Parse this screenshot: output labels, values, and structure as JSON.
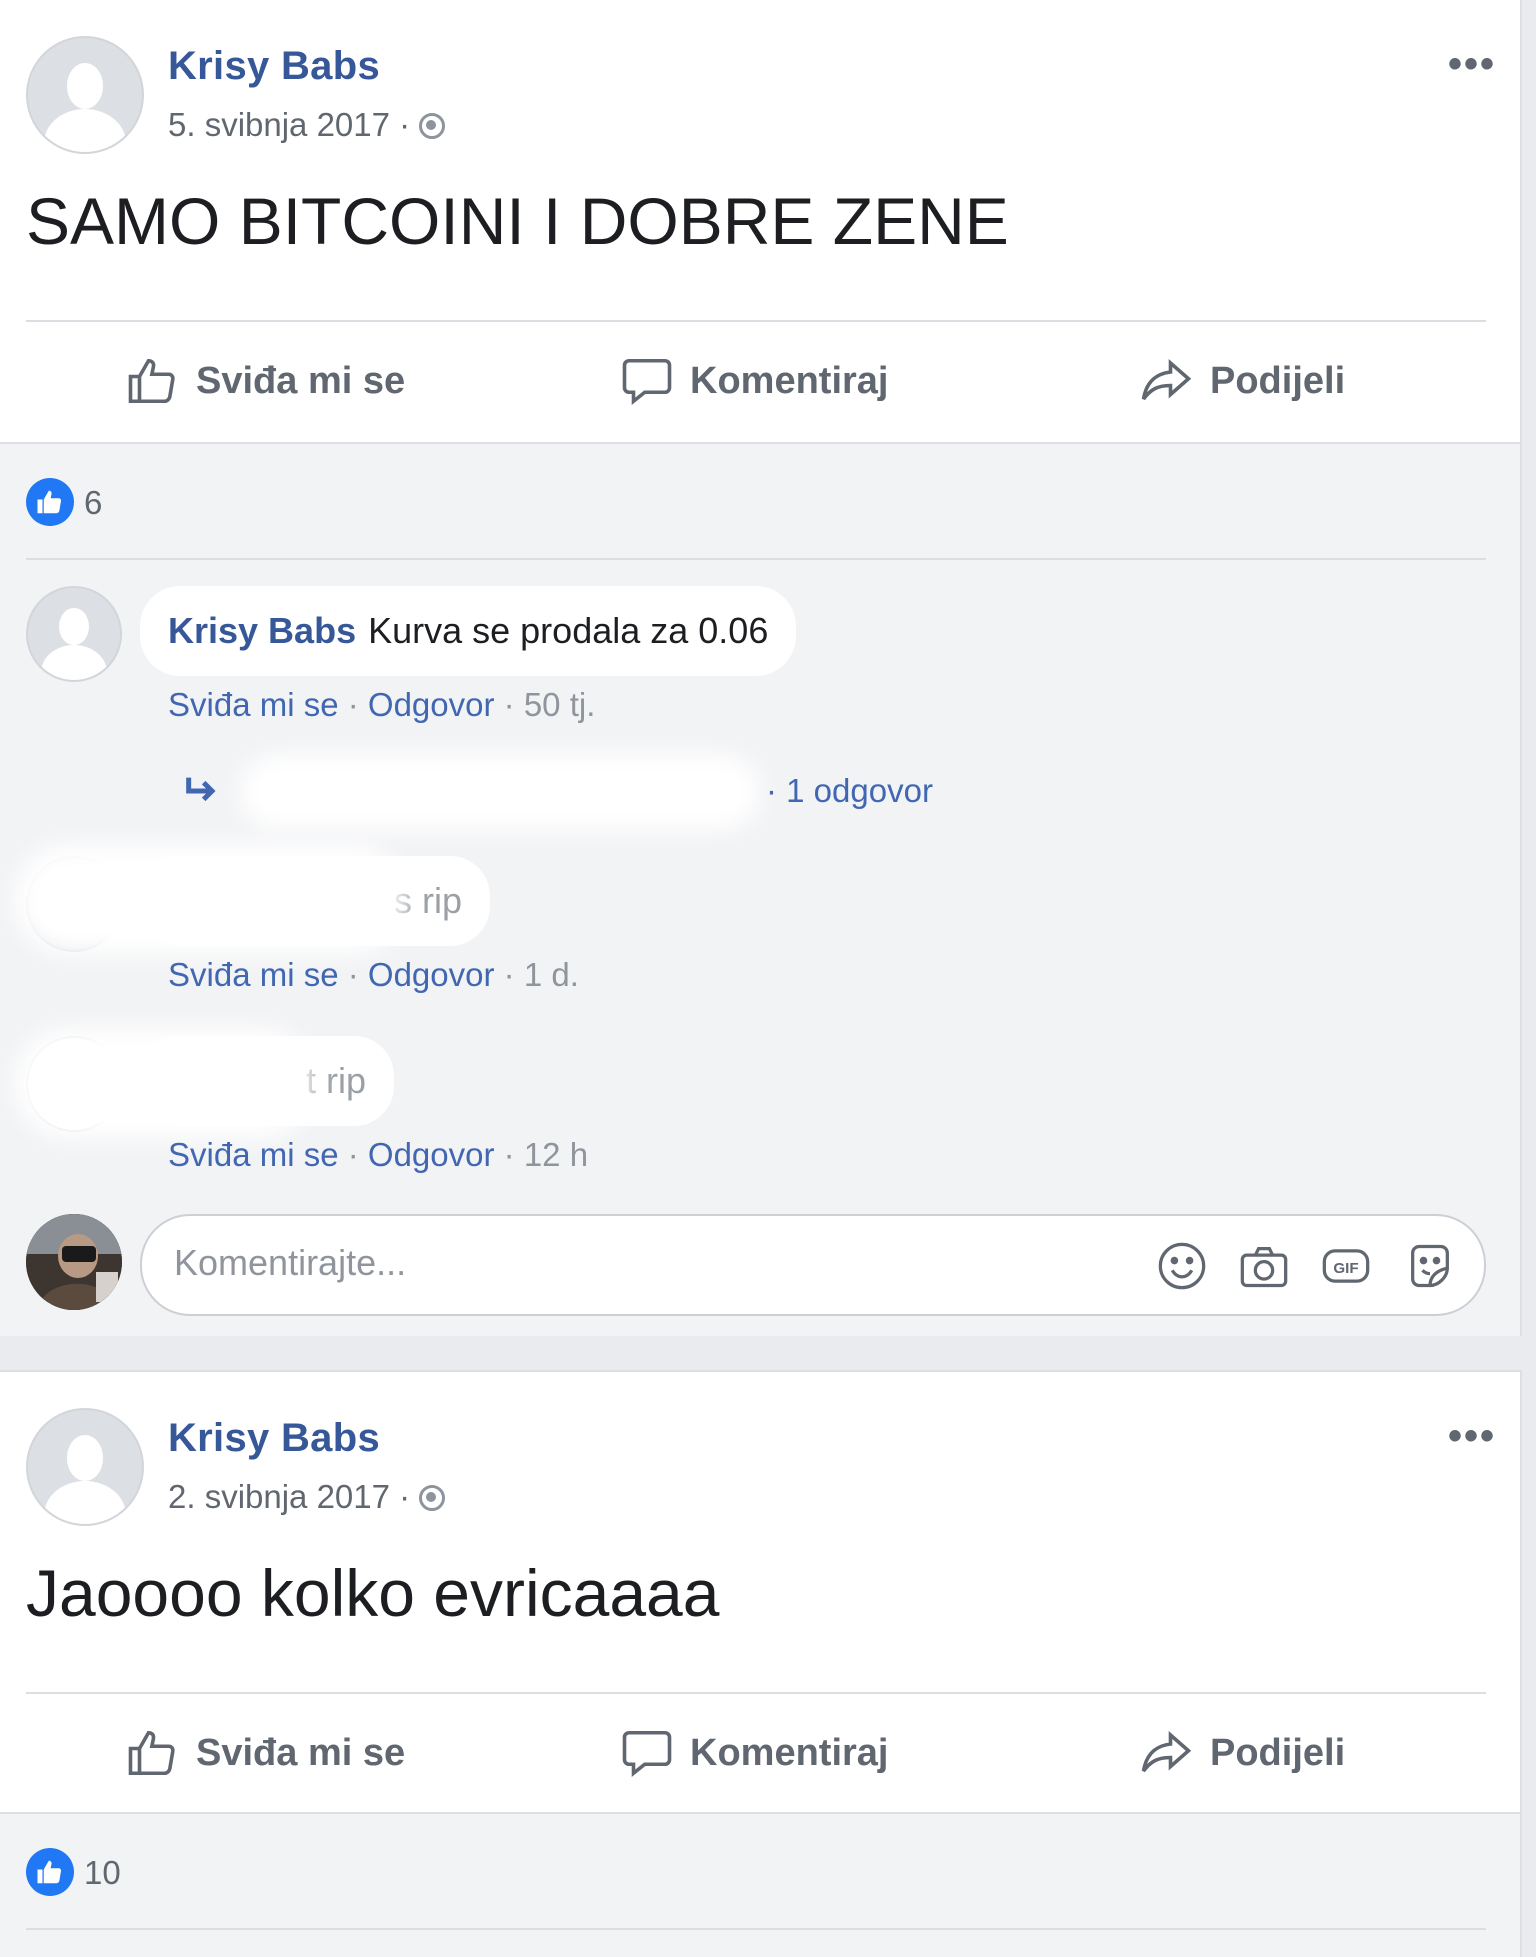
{
  "posts": [
    {
      "author": "Krisy Babs",
      "date": "5. svibnja 2017",
      "separator": "·",
      "more_label": "•••",
      "text": "SAMO BITCOINI I DOBRE ZENE",
      "actions": {
        "like": "Sviđa mi se",
        "comment": "Komentiraj",
        "share": "Podijeli"
      },
      "reactions_count": "6"
    },
    {
      "author": "Krisy Babs",
      "date": "2. svibnja 2017",
      "separator": "·",
      "more_label": "•••",
      "text": "Jaoooo kolko evricaaaa",
      "actions": {
        "like": "Sviđa mi se",
        "comment": "Komentiraj",
        "share": "Podijeli"
      },
      "reactions_count": "10"
    }
  ],
  "comments": [
    {
      "author": "Krisy Babs",
      "text": "Kurva se prodala za 0.06",
      "like": "Sviđa mi se",
      "reply": "Odgovor",
      "time": "50 tj.",
      "replies_label": "· 1 odgovor"
    },
    {
      "author": "",
      "text": "s rip",
      "like": "Sviđa mi se",
      "reply": "Odgovor",
      "time": "1 d."
    },
    {
      "author": "",
      "text": "t rip",
      "like": "Sviđa mi se",
      "reply": "Odgovor",
      "time": "12 h"
    }
  ],
  "dot": "·",
  "composer": {
    "placeholder": "Komentirajte...",
    "icons": [
      "smiley-icon",
      "camera-icon",
      "gif-icon",
      "sticker-icon"
    ],
    "gif_label": "GIF"
  },
  "colors": {
    "link": "#365899",
    "like_blue": "#2078f4",
    "background": "#e9ebee",
    "card": "#ffffff"
  }
}
